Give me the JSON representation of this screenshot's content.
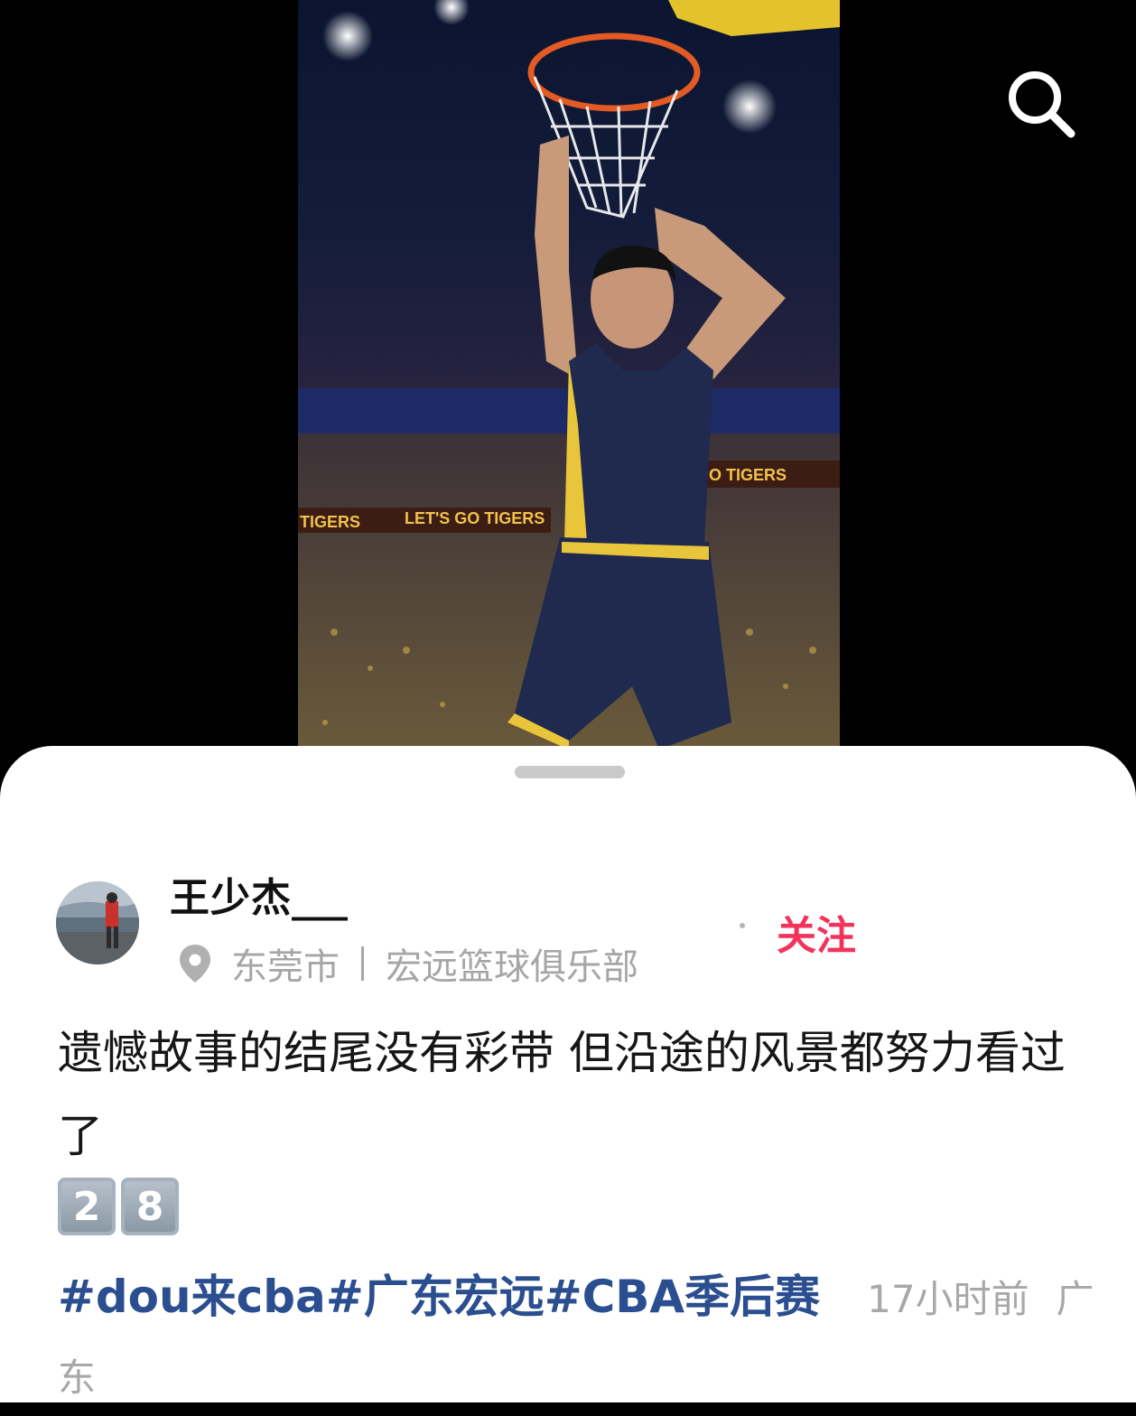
{
  "media": {
    "search_icon": "search-icon",
    "arena_banner_left": "TIGERS",
    "arena_banner_center": "LET'S GO TIGERS",
    "arena_banner_right": "O TIGERS"
  },
  "post": {
    "author": {
      "name": "王少杰",
      "name_suffix": "___",
      "location": "东莞市",
      "organization": "宏远篮球俱乐部"
    },
    "follow_label": "关注",
    "caption": "遗憾故事的结尾没有彩带  但沿途的风景都努力看过了",
    "emoji_digits": [
      "2",
      "8"
    ],
    "tags": [
      "#dou来cba",
      "#广东宏远",
      "#CBA季后赛"
    ],
    "time": "17小时前",
    "region": "广东"
  },
  "colors": {
    "accent_follow": "#f2335a",
    "hashtag": "#2a4e8f",
    "muted_text": "#a6a6a6"
  }
}
